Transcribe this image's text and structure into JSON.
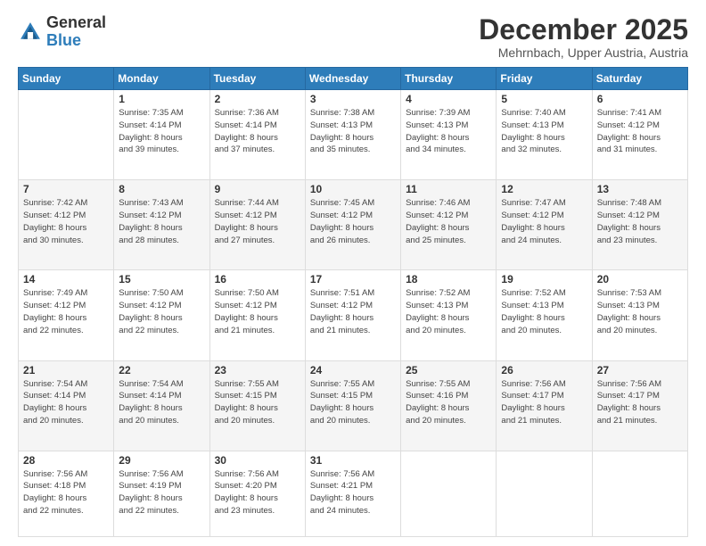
{
  "header": {
    "logo_general": "General",
    "logo_blue": "Blue",
    "month_title": "December 2025",
    "location": "Mehrnbach, Upper Austria, Austria"
  },
  "days_of_week": [
    "Sunday",
    "Monday",
    "Tuesday",
    "Wednesday",
    "Thursday",
    "Friday",
    "Saturday"
  ],
  "weeks": [
    [
      {
        "day": "",
        "info": ""
      },
      {
        "day": "1",
        "info": "Sunrise: 7:35 AM\nSunset: 4:14 PM\nDaylight: 8 hours\nand 39 minutes."
      },
      {
        "day": "2",
        "info": "Sunrise: 7:36 AM\nSunset: 4:14 PM\nDaylight: 8 hours\nand 37 minutes."
      },
      {
        "day": "3",
        "info": "Sunrise: 7:38 AM\nSunset: 4:13 PM\nDaylight: 8 hours\nand 35 minutes."
      },
      {
        "day": "4",
        "info": "Sunrise: 7:39 AM\nSunset: 4:13 PM\nDaylight: 8 hours\nand 34 minutes."
      },
      {
        "day": "5",
        "info": "Sunrise: 7:40 AM\nSunset: 4:13 PM\nDaylight: 8 hours\nand 32 minutes."
      },
      {
        "day": "6",
        "info": "Sunrise: 7:41 AM\nSunset: 4:12 PM\nDaylight: 8 hours\nand 31 minutes."
      }
    ],
    [
      {
        "day": "7",
        "info": "Sunrise: 7:42 AM\nSunset: 4:12 PM\nDaylight: 8 hours\nand 30 minutes."
      },
      {
        "day": "8",
        "info": "Sunrise: 7:43 AM\nSunset: 4:12 PM\nDaylight: 8 hours\nand 28 minutes."
      },
      {
        "day": "9",
        "info": "Sunrise: 7:44 AM\nSunset: 4:12 PM\nDaylight: 8 hours\nand 27 minutes."
      },
      {
        "day": "10",
        "info": "Sunrise: 7:45 AM\nSunset: 4:12 PM\nDaylight: 8 hours\nand 26 minutes."
      },
      {
        "day": "11",
        "info": "Sunrise: 7:46 AM\nSunset: 4:12 PM\nDaylight: 8 hours\nand 25 minutes."
      },
      {
        "day": "12",
        "info": "Sunrise: 7:47 AM\nSunset: 4:12 PM\nDaylight: 8 hours\nand 24 minutes."
      },
      {
        "day": "13",
        "info": "Sunrise: 7:48 AM\nSunset: 4:12 PM\nDaylight: 8 hours\nand 23 minutes."
      }
    ],
    [
      {
        "day": "14",
        "info": "Sunrise: 7:49 AM\nSunset: 4:12 PM\nDaylight: 8 hours\nand 22 minutes."
      },
      {
        "day": "15",
        "info": "Sunrise: 7:50 AM\nSunset: 4:12 PM\nDaylight: 8 hours\nand 22 minutes."
      },
      {
        "day": "16",
        "info": "Sunrise: 7:50 AM\nSunset: 4:12 PM\nDaylight: 8 hours\nand 21 minutes."
      },
      {
        "day": "17",
        "info": "Sunrise: 7:51 AM\nSunset: 4:12 PM\nDaylight: 8 hours\nand 21 minutes."
      },
      {
        "day": "18",
        "info": "Sunrise: 7:52 AM\nSunset: 4:13 PM\nDaylight: 8 hours\nand 20 minutes."
      },
      {
        "day": "19",
        "info": "Sunrise: 7:52 AM\nSunset: 4:13 PM\nDaylight: 8 hours\nand 20 minutes."
      },
      {
        "day": "20",
        "info": "Sunrise: 7:53 AM\nSunset: 4:13 PM\nDaylight: 8 hours\nand 20 minutes."
      }
    ],
    [
      {
        "day": "21",
        "info": "Sunrise: 7:54 AM\nSunset: 4:14 PM\nDaylight: 8 hours\nand 20 minutes."
      },
      {
        "day": "22",
        "info": "Sunrise: 7:54 AM\nSunset: 4:14 PM\nDaylight: 8 hours\nand 20 minutes."
      },
      {
        "day": "23",
        "info": "Sunrise: 7:55 AM\nSunset: 4:15 PM\nDaylight: 8 hours\nand 20 minutes."
      },
      {
        "day": "24",
        "info": "Sunrise: 7:55 AM\nSunset: 4:15 PM\nDaylight: 8 hours\nand 20 minutes."
      },
      {
        "day": "25",
        "info": "Sunrise: 7:55 AM\nSunset: 4:16 PM\nDaylight: 8 hours\nand 20 minutes."
      },
      {
        "day": "26",
        "info": "Sunrise: 7:56 AM\nSunset: 4:17 PM\nDaylight: 8 hours\nand 21 minutes."
      },
      {
        "day": "27",
        "info": "Sunrise: 7:56 AM\nSunset: 4:17 PM\nDaylight: 8 hours\nand 21 minutes."
      }
    ],
    [
      {
        "day": "28",
        "info": "Sunrise: 7:56 AM\nSunset: 4:18 PM\nDaylight: 8 hours\nand 22 minutes."
      },
      {
        "day": "29",
        "info": "Sunrise: 7:56 AM\nSunset: 4:19 PM\nDaylight: 8 hours\nand 22 minutes."
      },
      {
        "day": "30",
        "info": "Sunrise: 7:56 AM\nSunset: 4:20 PM\nDaylight: 8 hours\nand 23 minutes."
      },
      {
        "day": "31",
        "info": "Sunrise: 7:56 AM\nSunset: 4:21 PM\nDaylight: 8 hours\nand 24 minutes."
      },
      {
        "day": "",
        "info": ""
      },
      {
        "day": "",
        "info": ""
      },
      {
        "day": "",
        "info": ""
      }
    ]
  ]
}
